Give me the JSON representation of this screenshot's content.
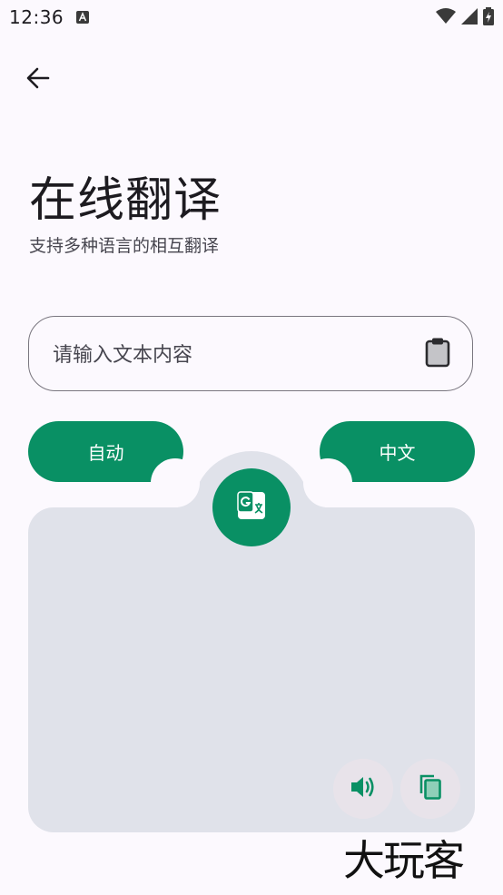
{
  "status_bar": {
    "time": "12:36",
    "icons": [
      "a-notification-icon",
      "wifi-icon",
      "signal-icon",
      "battery-charging-icon"
    ]
  },
  "header": {
    "back_icon": "arrow-left-icon",
    "title": "在线翻译",
    "subtitle": "支持多种语言的相互翻译"
  },
  "input": {
    "placeholder": "请输入文本内容",
    "value": "",
    "clipboard_icon": "clipboard-icon"
  },
  "languages": {
    "source_label": "自动",
    "target_label": "中文"
  },
  "translate": {
    "icon": "google-translate-icon"
  },
  "result": {
    "text": "",
    "speak_icon": "volume-icon",
    "copy_icon": "copy-icon"
  },
  "watermark": {
    "text": "大玩客"
  },
  "colors": {
    "accent": "#099064",
    "panel": "#e0e2ea",
    "background": "#fcf9fe"
  }
}
